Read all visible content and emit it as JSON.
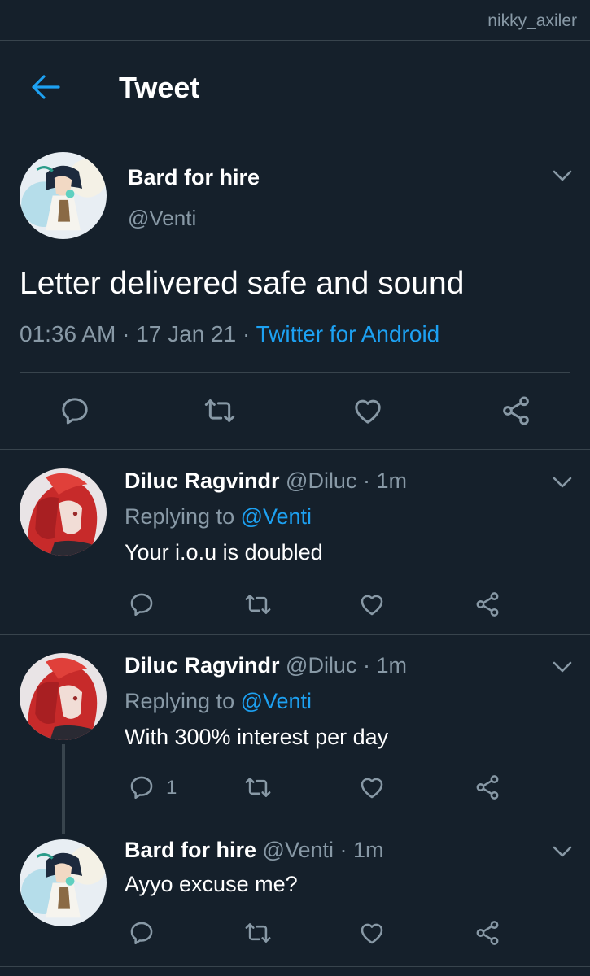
{
  "watermark": "nikky_axiler",
  "header": {
    "title": "Tweet",
    "back_icon": "arrow-left-icon"
  },
  "colors": {
    "background": "#15202b",
    "accent": "#1da1f2",
    "muted": "#8899a6",
    "divider": "#38444d"
  },
  "main_tweet": {
    "name": "Bard for hire",
    "handle": "@Venti",
    "text": "Letter delivered safe and sound",
    "time": "01:36 AM",
    "date": "17 Jan 21",
    "source": "Twitter for Android",
    "sep1": " · ",
    "sep2": " · "
  },
  "replies": [
    {
      "name": "Diluc Ragvindr",
      "meta": " @Diluc · 1m",
      "replying_prefix": "Replying to ",
      "replying_to": "@Venti",
      "text": "Your i.o.u is doubled",
      "reply_count": ""
    },
    {
      "name": "Diluc Ragvindr",
      "meta": " @Diluc · 1m",
      "replying_prefix": "Replying to ",
      "replying_to": "@Venti",
      "text": "With 300% interest per day",
      "reply_count": "1"
    },
    {
      "name": "Bard for hire",
      "meta": " @Venti · 1m",
      "text": "Ayyo excuse me?"
    }
  ],
  "icons": [
    "reply-icon",
    "retweet-icon",
    "like-icon",
    "share-icon",
    "chevron-down-icon"
  ]
}
